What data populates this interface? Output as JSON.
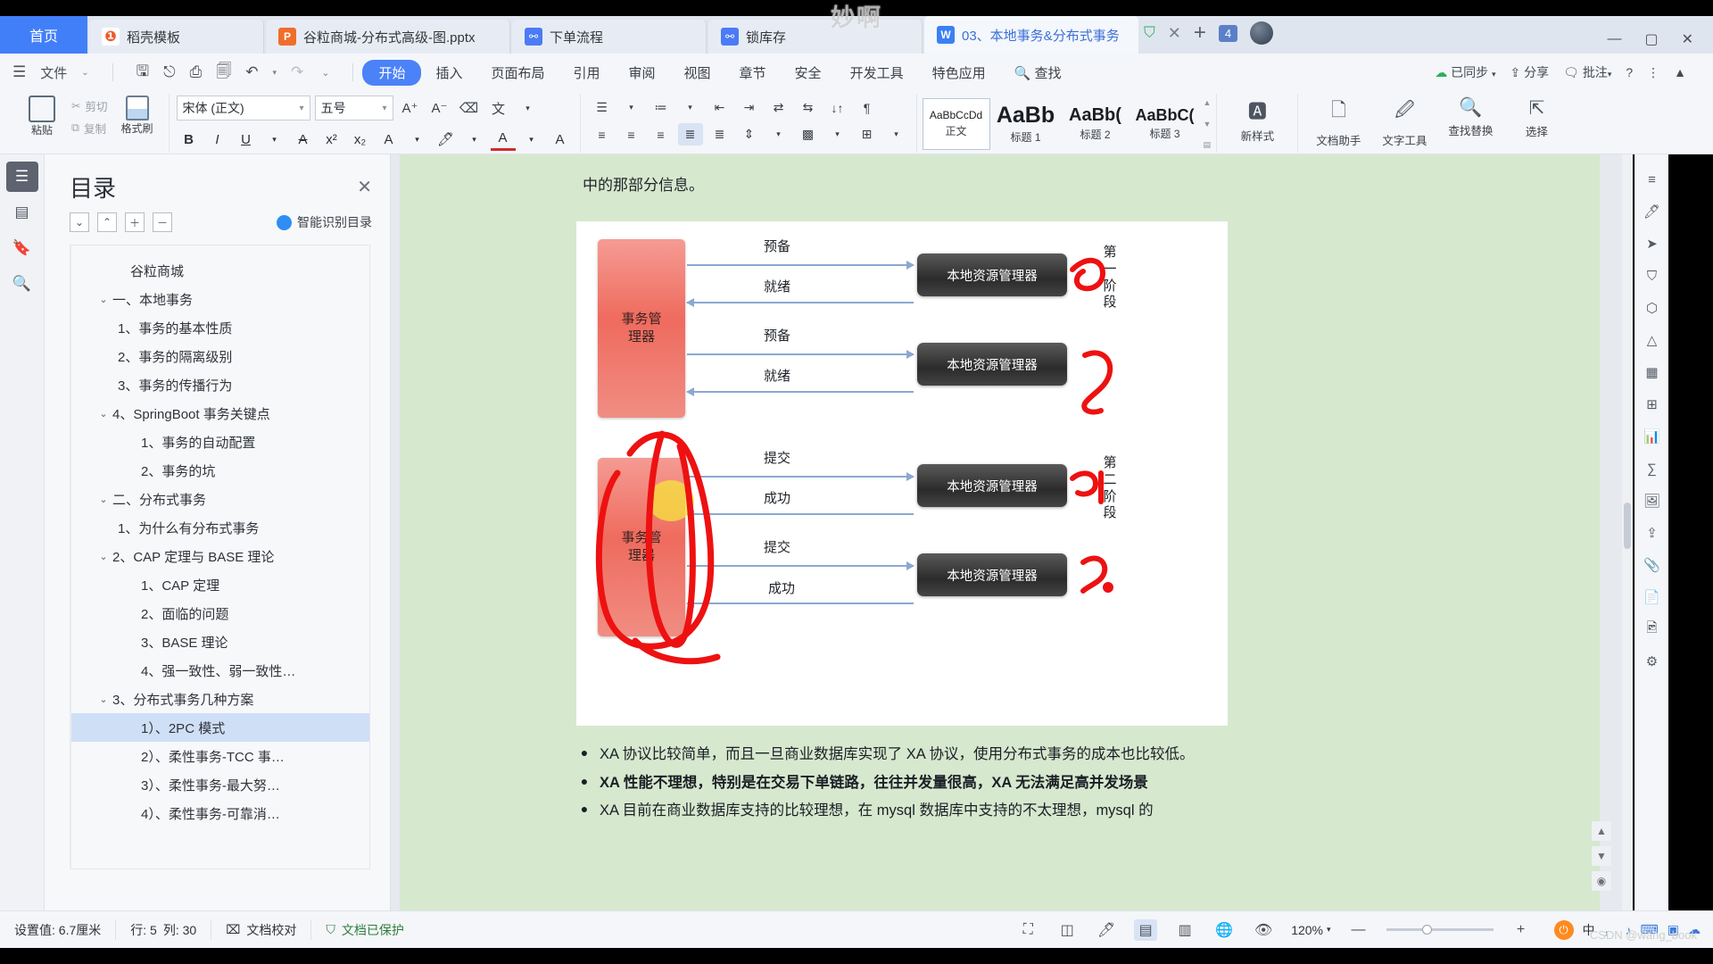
{
  "watermark": "妙啊",
  "credit": "CSDN @wang_book",
  "tabbar": {
    "home": "首页",
    "tabs": [
      {
        "label": "稻壳模板",
        "icon": "docer-icon"
      },
      {
        "label": "谷粒商城-分布式高级-图.pptx",
        "icon": "powerpoint-icon"
      },
      {
        "label": "下单流程",
        "icon": "flowchart-icon"
      },
      {
        "label": "锁库存",
        "icon": "flowchart-icon"
      },
      {
        "label": "03、本地事务&分布式事务",
        "icon": "word-icon",
        "active": true
      }
    ],
    "tab_count": "4",
    "new_tab": "+",
    "close": "✕",
    "shield": "shield-icon",
    "minimize": "—",
    "maximize": "▢",
    "close_window": "✕"
  },
  "ribbon": {
    "file_menu": "文件",
    "quick_access": [
      "save-icon",
      "cloud-sync-icon",
      "print-icon",
      "print-preview-icon",
      "undo-icon",
      "redo-icon",
      "more-icon"
    ],
    "tabs": [
      "开始",
      "插入",
      "页面布局",
      "引用",
      "审阅",
      "视图",
      "章节",
      "安全",
      "开发工具",
      "特色应用"
    ],
    "selected_tab": "开始",
    "find": "查找",
    "right_items": [
      "已同步",
      "分享",
      "批注",
      "?",
      "⋮",
      "▲"
    ],
    "clipboard": {
      "paste": "粘贴",
      "cut": "剪切",
      "copy": "复制",
      "format_painter": "格式刷"
    },
    "font": {
      "family": "宋体 (正文)",
      "size": "五号",
      "grow": "A⁺",
      "shrink": "A⁻",
      "clear_format": "clear-format-icon",
      "pinyin": "pinyin-guide-icon",
      "bold": "B",
      "italic": "I",
      "underline": "U",
      "strikethrough": "A",
      "superscript": "x²",
      "subscript": "x₂",
      "char_border": "A",
      "highlight": "highlight-icon",
      "font_color": "A",
      "char_shading": "A"
    },
    "paragraph": {
      "bullets": "bullet-list-icon",
      "numbering": "numbered-list-icon",
      "multilevel": "multilevel-list-icon",
      "dec_indent": "decrease-indent-icon",
      "inc_indent": "increase-indent-icon",
      "ltr": "ltr-icon",
      "rtl": "rtl-icon",
      "sort": "sort-icon",
      "show_marks": "show-marks-icon",
      "align_left": "align-left-icon",
      "align_center": "align-center-icon",
      "align_right": "align-right-icon",
      "justify": "justify-icon",
      "distribute": "distribute-icon",
      "line_spacing": "line-spacing-icon",
      "shading": "shading-icon",
      "borders": "borders-icon"
    },
    "styles": [
      {
        "preview": "AaBbCcDd",
        "label": "正文",
        "selected": true
      },
      {
        "preview": "AaBb",
        "label": "标题 1"
      },
      {
        "preview": "AaBb(",
        "label": "标题 2"
      },
      {
        "preview": "AaBbC(",
        "label": "标题 3"
      }
    ],
    "style_new": "新样式",
    "tools": [
      {
        "label": "文档助手",
        "icon": "doc-assistant-icon"
      },
      {
        "label": "文字工具",
        "icon": "text-tools-icon"
      },
      {
        "label": "查找替换",
        "icon": "find-replace-icon"
      },
      {
        "label": "选择",
        "icon": "select-icon"
      }
    ]
  },
  "rail": [
    "menu-icon",
    "pages-icon",
    "bookmark-icon",
    "zoom-icon"
  ],
  "toc": {
    "title": "目录",
    "close": "✕",
    "tool_buttons": [
      "collapse-all-icon",
      "expand-up-icon",
      "expand-plus-icon",
      "collapse-minus-icon"
    ],
    "smart_label": "智能识别目录",
    "items": [
      {
        "label": "谷粒商城",
        "level": 0,
        "chevron": ""
      },
      {
        "label": "一、本地事务",
        "level": 1,
        "chevron": "⌄"
      },
      {
        "label": "1、事务的基本性质",
        "level": 2,
        "chevron": ""
      },
      {
        "label": "2、事务的隔离级别",
        "level": 2,
        "chevron": ""
      },
      {
        "label": "3、事务的传播行为",
        "level": 2,
        "chevron": ""
      },
      {
        "label": "4、SpringBoot 事务关键点",
        "level": 2,
        "chevron": "⌄"
      },
      {
        "label": "1、事务的自动配置",
        "level": 3,
        "chevron": ""
      },
      {
        "label": "2、事务的坑",
        "level": 3,
        "chevron": ""
      },
      {
        "label": "二、分布式事务",
        "level": 1,
        "chevron": "⌄"
      },
      {
        "label": "1、为什么有分布式事务",
        "level": 2,
        "chevron": ""
      },
      {
        "label": "2、CAP 定理与 BASE 理论",
        "level": 2,
        "chevron": "⌄"
      },
      {
        "label": "1、CAP 定理",
        "level": 3,
        "chevron": ""
      },
      {
        "label": "2、面临的问题",
        "level": 3,
        "chevron": ""
      },
      {
        "label": "3、BASE 理论",
        "level": 3,
        "chevron": ""
      },
      {
        "label": "4、强一致性、弱一致性…",
        "level": 3,
        "chevron": ""
      },
      {
        "label": "3、分布式事务几种方案",
        "level": 2,
        "chevron": "⌄"
      },
      {
        "label": "1）、2PC 模式",
        "level": 3,
        "chevron": "",
        "selected": true
      },
      {
        "label": "2）、柔性事务-TCC 事…",
        "level": 3,
        "chevron": ""
      },
      {
        "label": "3）、柔性事务-最大努…",
        "level": 3,
        "chevron": ""
      },
      {
        "label": "4）、柔性事务-可靠消…",
        "level": 3,
        "chevron": ""
      }
    ]
  },
  "document": {
    "top_line": "中的那部分信息。",
    "figure": {
      "tm_label": "事务管\n理器",
      "rm_label": "本地资源管理器",
      "phase1": "第一阶段",
      "phase2": "第二阶段",
      "arrows": [
        {
          "label": "预备",
          "dir": "right"
        },
        {
          "label": "就绪",
          "dir": "left"
        },
        {
          "label": "预备",
          "dir": "right"
        },
        {
          "label": "就绪",
          "dir": "left"
        },
        {
          "label": "提交",
          "dir": "right"
        },
        {
          "label": "成功",
          "dir": "left"
        },
        {
          "label": "提交",
          "dir": "right"
        },
        {
          "label": "成功",
          "dir": "left"
        }
      ],
      "annotation_color": "#ee1111",
      "highlight_color": "#f5e63c"
    },
    "bullets": [
      {
        "text": "XA 协议比较简单，而且一旦商业数据库实现了 XA 协议，使用分布式事务的成本也比较低。",
        "bold": false
      },
      {
        "text": "XA 性能不理想，特别是在交易下单链路，往往并发量很高，XA 无法满足高并发场景",
        "bold": true
      },
      {
        "text": "XA 目前在商业数据库支持的比较理想，在 mysql 数据库中支持的不太理想，mysql 的",
        "bold": false
      }
    ]
  },
  "status": {
    "page_setting": "设置值: 6.7厘米",
    "row": "行: 5",
    "col": "列: 30",
    "proofread": "文档校对",
    "protected": "文档已保护",
    "view_buttons": [
      "fullscreen-icon",
      "page-layout-icon",
      "edit-mode-icon",
      "print-layout-icon",
      "reading-layout-icon",
      "web-layout-icon",
      "eye-icon"
    ],
    "zoom": "120%",
    "zoom_out": "—",
    "zoom_in": "+",
    "ime": [
      "中",
      "·",
      "♪",
      "⌨",
      "▣",
      "☁"
    ]
  }
}
